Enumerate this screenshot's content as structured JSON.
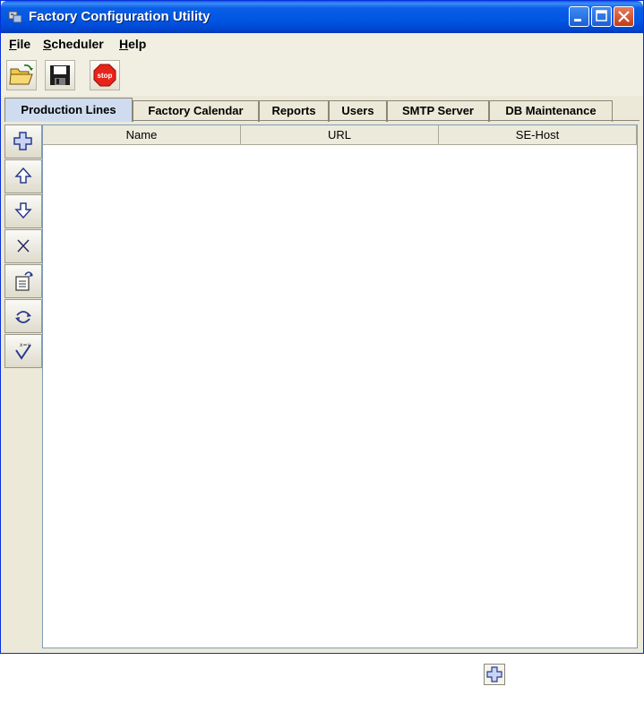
{
  "window": {
    "title": "Factory Configuration Utility",
    "title_bar_color": "#0054e3",
    "controls": [
      "minimize-icon",
      "maximize-icon",
      "close-icon"
    ]
  },
  "menu": [
    {
      "label": "File",
      "mnemonic": "F"
    },
    {
      "label": "Scheduler",
      "mnemonic": "S"
    },
    {
      "label": "Help",
      "mnemonic": "H"
    }
  ],
  "toolbar": {
    "open_icon": "folder-open-icon",
    "save_icon": "floppy-disk-icon",
    "stop_icon": "stop-sign-icon",
    "stop_text": "stop"
  },
  "tabs": [
    {
      "label": "Production Lines",
      "active": true
    },
    {
      "label": "Factory Calendar",
      "active": false
    },
    {
      "label": "Reports",
      "active": false
    },
    {
      "label": "Users",
      "active": false
    },
    {
      "label": "SMTP Server",
      "active": false
    },
    {
      "label": "DB Maintenance",
      "active": false
    }
  ],
  "side_buttons": [
    "add-icon",
    "move-up-icon",
    "move-down-icon",
    "delete-icon",
    "edit-properties-icon",
    "refresh-icon",
    "validate-icon"
  ],
  "table": {
    "columns": [
      "Name",
      "URL",
      "SE-Host"
    ],
    "rows": []
  }
}
